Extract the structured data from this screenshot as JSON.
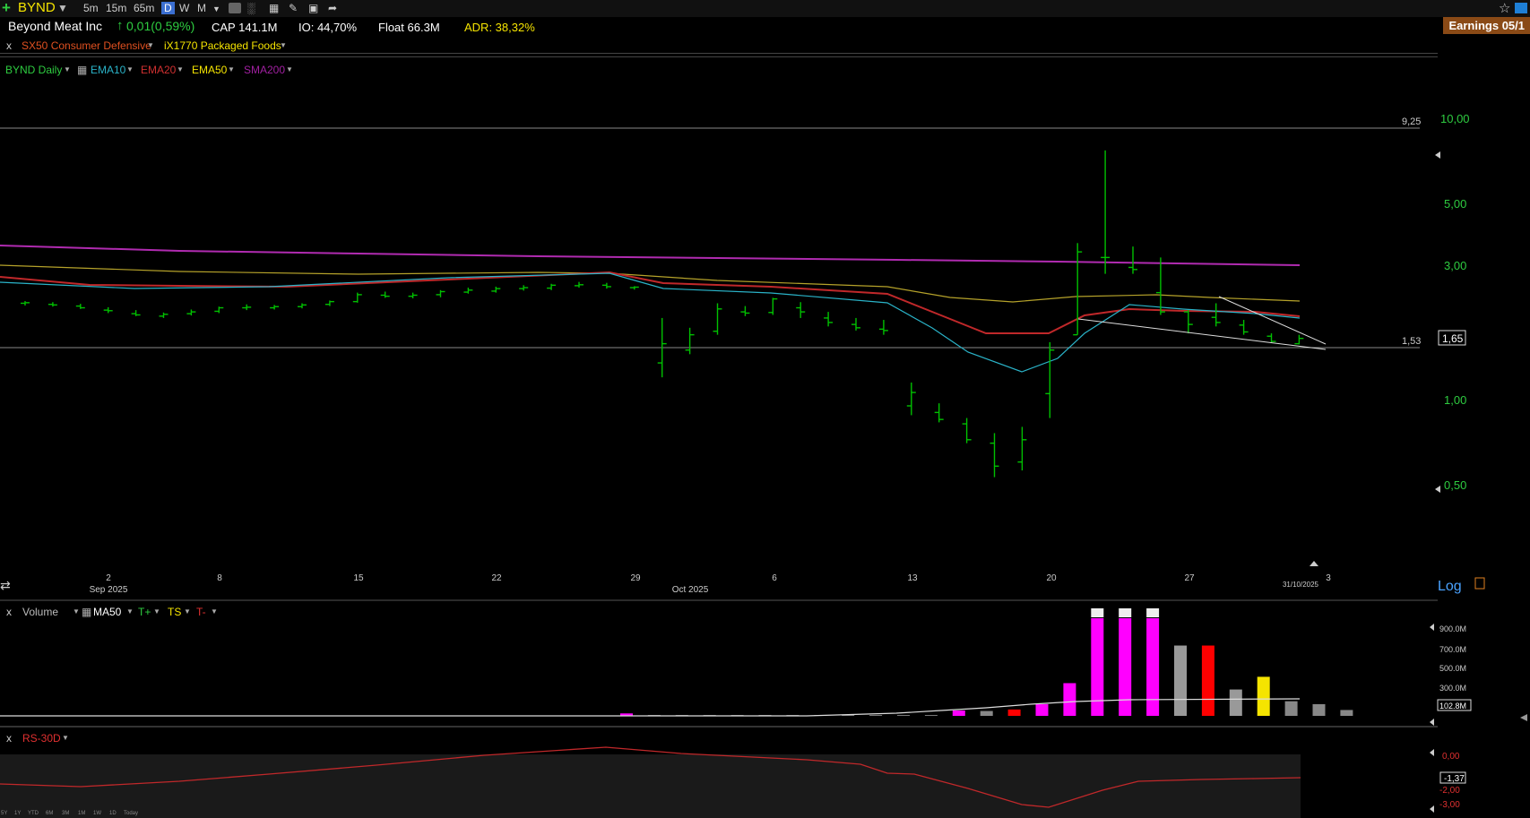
{
  "toolbar": {
    "plus": "+",
    "ticker": "BYND",
    "timeframes": [
      "5m",
      "15m",
      "65m",
      "D",
      "W",
      "M"
    ],
    "active_timeframe": "D"
  },
  "info": {
    "company": "Beyond Meat Inc",
    "change": "0,01(0,59%)",
    "cap": "CAP 141.1M",
    "io": "IO: 44,70%",
    "float": "Float 66.3M",
    "adr": "ADR: 38,32%",
    "earnings": "Earnings 05/1"
  },
  "sector": {
    "close": "x",
    "sector": "SX50 Consumer Defensive",
    "industry": "iX1770 Packaged Foods"
  },
  "legend": {
    "symbol": "BYND Daily",
    "ema10": "EMA10",
    "ema20": "EMA20",
    "ema50": "EMA50",
    "sma200": "SMA200"
  },
  "price_axis": {
    "ticks": [
      "10,00",
      "5,00",
      "3,00",
      "1,00",
      "0,50"
    ],
    "last_price": "1,65",
    "hline_high": "9,25",
    "hline_low": "1,53",
    "log_label": "Log"
  },
  "date_axis": {
    "ticks": [
      "2",
      "8",
      "15",
      "22",
      "29",
      "6",
      "13",
      "20",
      "27",
      "3"
    ],
    "months": [
      "Sep 2025",
      "Oct 2025"
    ],
    "current_date": "31/10/2025"
  },
  "volume_panel": {
    "close": "x",
    "title": "Volume",
    "ma": "MA50",
    "tplus": "T+",
    "ts": "TS",
    "tminus": "T-",
    "ticks": [
      "900.0M",
      "700.0M",
      "500.0M",
      "300.0M"
    ],
    "last": "102.8M"
  },
  "rs_panel": {
    "close": "x",
    "title": "RS-30D",
    "ticks": [
      "0,00",
      "-2,00",
      "-3,00"
    ],
    "last": "-1,37"
  },
  "ranges": [
    "5Y",
    "1Y",
    "YTD",
    "6M",
    "3M",
    "1M",
    "1W",
    "1D",
    "Today"
  ],
  "colors": {
    "up": "#00c000",
    "ema10": "#2ab3c8",
    "ema20": "#c0282a",
    "ema50": "#b5a22a",
    "sma200": "#b02bb0",
    "magenta": "#ff00ff",
    "accent_yellow": "#f5e400"
  },
  "chart_data": {
    "type": "ohlc",
    "title": "BYND Daily",
    "scale": "log",
    "ylim": [
      0.37,
      12
    ],
    "dates": [
      "2025-08-27",
      "2025-08-28",
      "2025-08-29",
      "2025-09-02",
      "2025-09-03",
      "2025-09-04",
      "2025-09-05",
      "2025-09-08",
      "2025-09-09",
      "2025-09-10",
      "2025-09-11",
      "2025-09-12",
      "2025-09-15",
      "2025-09-16",
      "2025-09-17",
      "2025-09-18",
      "2025-09-19",
      "2025-09-22",
      "2025-09-23",
      "2025-09-24",
      "2025-09-25",
      "2025-09-26",
      "2025-09-29",
      "2025-09-30",
      "2025-10-01",
      "2025-10-02",
      "2025-10-03",
      "2025-10-06",
      "2025-10-07",
      "2025-10-08",
      "2025-10-09",
      "2025-10-10",
      "2025-10-13",
      "2025-10-14",
      "2025-10-15",
      "2025-10-16",
      "2025-10-17",
      "2025-10-20",
      "2025-10-21",
      "2025-10-22",
      "2025-10-23",
      "2025-10-24",
      "2025-10-27",
      "2025-10-28",
      "2025-10-29",
      "2025-10-30",
      "2025-10-31"
    ],
    "ohlc": [
      [
        2.2,
        2.24,
        2.16,
        2.21
      ],
      [
        2.18,
        2.22,
        2.14,
        2.17
      ],
      [
        2.15,
        2.19,
        2.1,
        2.12
      ],
      [
        2.08,
        2.13,
        2.03,
        2.07
      ],
      [
        2.02,
        2.08,
        1.98,
        2.0
      ],
      [
        1.98,
        2.04,
        1.95,
        2.01
      ],
      [
        2.02,
        2.09,
        1.99,
        2.05
      ],
      [
        2.06,
        2.14,
        2.03,
        2.12
      ],
      [
        2.12,
        2.18,
        2.08,
        2.13
      ],
      [
        2.12,
        2.17,
        2.09,
        2.14
      ],
      [
        2.14,
        2.2,
        2.11,
        2.17
      ],
      [
        2.18,
        2.25,
        2.15,
        2.23
      ],
      [
        2.23,
        2.4,
        2.21,
        2.36
      ],
      [
        2.35,
        2.42,
        2.3,
        2.33
      ],
      [
        2.33,
        2.4,
        2.29,
        2.35
      ],
      [
        2.36,
        2.45,
        2.31,
        2.42
      ],
      [
        2.41,
        2.5,
        2.38,
        2.45
      ],
      [
        2.43,
        2.52,
        2.4,
        2.48
      ],
      [
        2.48,
        2.55,
        2.44,
        2.5
      ],
      [
        2.49,
        2.58,
        2.45,
        2.55
      ],
      [
        2.54,
        2.62,
        2.5,
        2.56
      ],
      [
        2.55,
        2.6,
        2.48,
        2.52
      ],
      [
        2.5,
        2.53,
        2.46,
        2.51
      ],
      [
        1.35,
        1.95,
        1.2,
        1.58
      ],
      [
        1.5,
        1.8,
        1.45,
        1.7
      ],
      [
        1.75,
        2.2,
        1.7,
        2.1
      ],
      [
        2.05,
        2.15,
        1.98,
        2.03
      ],
      [
        2.04,
        2.3,
        2.0,
        2.28
      ],
      [
        2.12,
        2.22,
        1.95,
        2.05
      ],
      [
        1.95,
        2.05,
        1.82,
        1.88
      ],
      [
        1.85,
        1.95,
        1.76,
        1.8
      ],
      [
        1.78,
        1.92,
        1.7,
        1.76
      ],
      [
        0.95,
        1.15,
        0.88,
        1.06
      ],
      [
        0.9,
        0.97,
        0.83,
        0.85
      ],
      [
        0.82,
        0.86,
        0.7,
        0.72
      ],
      [
        0.7,
        0.76,
        0.53,
        0.58
      ],
      [
        0.6,
        0.8,
        0.56,
        0.72
      ],
      [
        1.05,
        1.6,
        0.86,
        1.5
      ],
      [
        1.7,
        3.6,
        1.7,
        3.35
      ],
      [
        3.2,
        7.69,
        2.8,
        3.2
      ],
      [
        2.95,
        3.5,
        2.8,
        2.9
      ],
      [
        2.4,
        3.2,
        2.0,
        2.05
      ],
      [
        2.05,
        2.08,
        1.72,
        1.85
      ],
      [
        1.96,
        2.2,
        1.82,
        1.88
      ],
      [
        1.84,
        1.92,
        1.7,
        1.74
      ],
      [
        1.68,
        1.72,
        1.59,
        1.61
      ],
      [
        1.58,
        1.7,
        1.57,
        1.65
      ]
    ],
    "ema10_last": 1.9,
    "ema20_last": 1.97,
    "ema50_last": 2.15,
    "sma200_last": 2.96,
    "volume_m": [
      0,
      0,
      0,
      0,
      0,
      2,
      0,
      0,
      0,
      0,
      0,
      0,
      0,
      0,
      0,
      0,
      0,
      0,
      0,
      0,
      0,
      0,
      0,
      25,
      6,
      4,
      8,
      2,
      2,
      3,
      3,
      4,
      4,
      2,
      8,
      55,
      50,
      65,
      120,
      335,
      1000,
      1000,
      1000,
      720,
      720,
      270,
      400,
      150,
      120,
      60
    ]
  }
}
